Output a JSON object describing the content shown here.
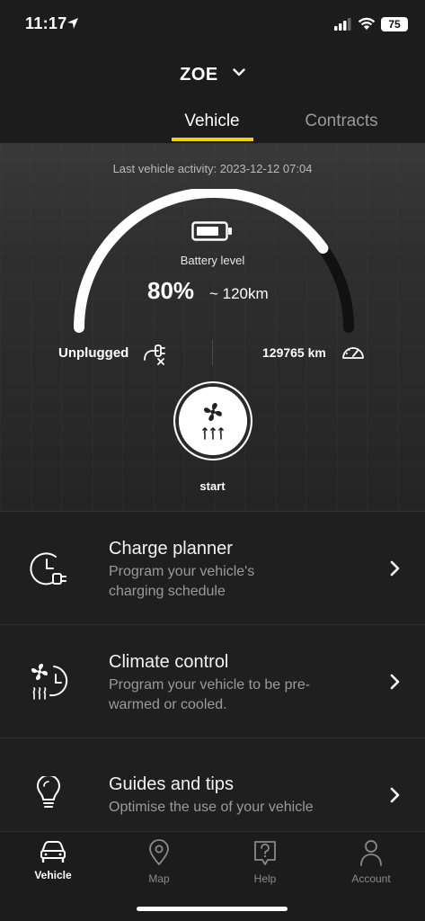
{
  "status_bar": {
    "time": "11:17",
    "battery_percent": "75",
    "icons": [
      "location-arrow-icon",
      "signal-bars-icon",
      "wifi-icon",
      "battery-icon"
    ]
  },
  "header": {
    "vehicle_name": "ZOE",
    "tabs": [
      {
        "label": "Vehicle",
        "active": true
      },
      {
        "label": "Contracts",
        "active": false
      }
    ],
    "accent_color": "#f2d200"
  },
  "hero": {
    "last_activity": "Last vehicle activity: 2023-12-12 07:04",
    "battery_label": "Battery level",
    "battery_percent_text": "80%",
    "battery_level": 0.8,
    "range_text": "~ 120km",
    "plug_status": "Unplugged",
    "odometer": "129765 km",
    "start_label": "start"
  },
  "cards": [
    {
      "icon": "clock-plug-icon",
      "title": "Charge planner",
      "subtitle_line1": "Program your vehicle's",
      "subtitle_line2": "charging schedule"
    },
    {
      "icon": "fan-heat-clock-icon",
      "title": "Climate control",
      "subtitle_line1": "Program your vehicle to be pre-",
      "subtitle_line2": "warmed or cooled."
    },
    {
      "icon": "lightbulb-icon",
      "title": "Guides and tips",
      "subtitle_line1": "Optimise the use of your vehicle",
      "subtitle_line2": ""
    }
  ],
  "tabbar": {
    "items": [
      {
        "label": "Vehicle",
        "icon": "car-icon",
        "active": true
      },
      {
        "label": "Map",
        "icon": "map-pin-icon",
        "active": false
      },
      {
        "label": "Help",
        "icon": "help-icon",
        "active": false
      },
      {
        "label": "Account",
        "icon": "account-icon",
        "active": false
      }
    ]
  }
}
